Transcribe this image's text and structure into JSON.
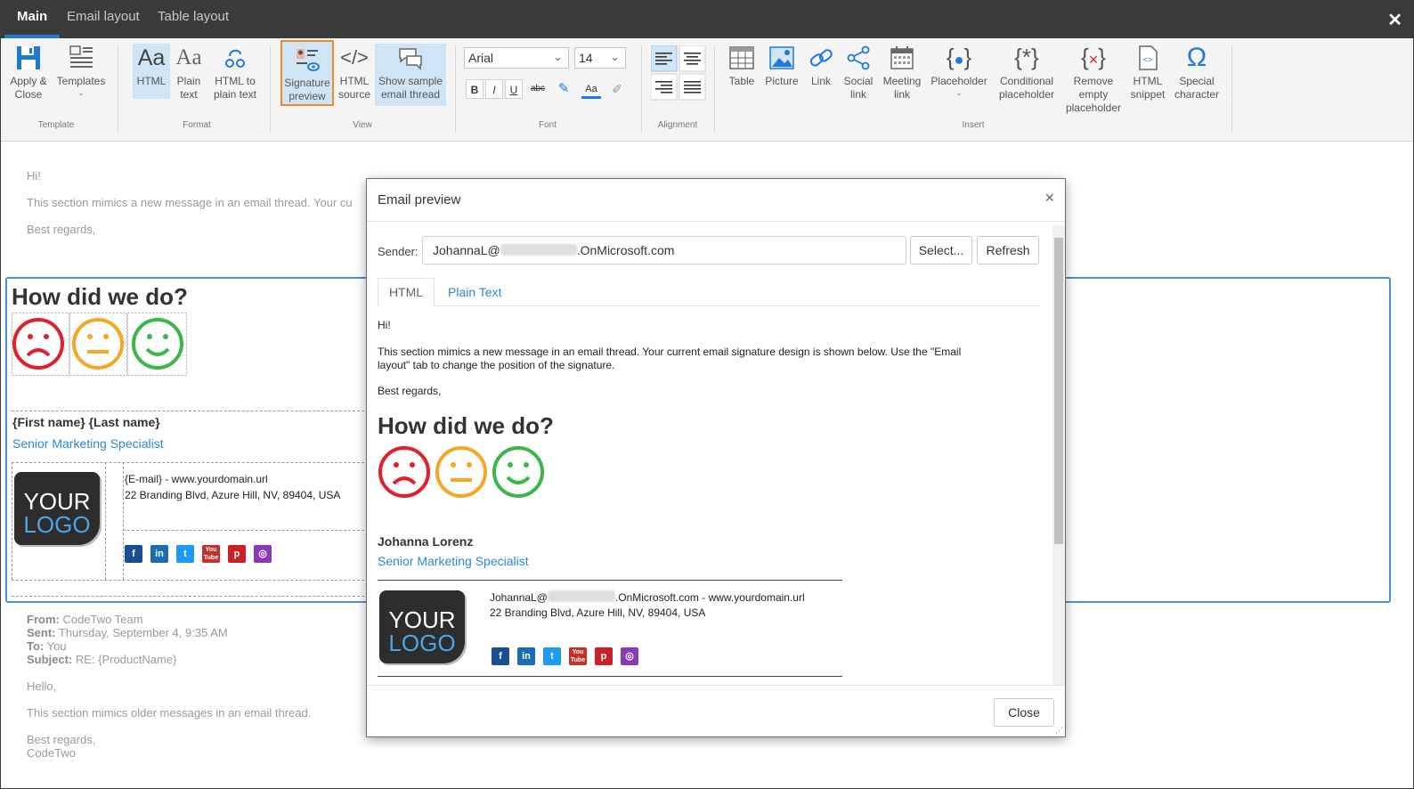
{
  "tabs": [
    "Main",
    "Email layout",
    "Table layout"
  ],
  "window_close": "✕",
  "ribbon": {
    "template": {
      "label": "Template",
      "apply_close": [
        "Apply &",
        "Close"
      ],
      "templates": "Templates"
    },
    "format": {
      "label": "Format",
      "html": "HTML",
      "plain_text": [
        "Plain",
        "text"
      ],
      "html_to_plain": [
        "HTML to",
        "plain text"
      ]
    },
    "view": {
      "label": "View",
      "signature_preview": [
        "Signature",
        "preview"
      ],
      "html_source": [
        "HTML",
        "source"
      ],
      "show_sample": [
        "Show sample",
        "email thread"
      ]
    },
    "font": {
      "label": "Font",
      "family": "Arial",
      "size": "14",
      "bold": "B",
      "italic": "I",
      "underline": "U",
      "strikethrough": "abc",
      "font_color": "Aa"
    },
    "alignment": {
      "label": "Alignment"
    },
    "insert": {
      "label": "Insert",
      "table": "Table",
      "picture": "Picture",
      "link": "Link",
      "social_link": [
        "Social",
        "link"
      ],
      "meeting_link": [
        "Meeting",
        "link"
      ],
      "placeholder": "Placeholder",
      "conditional_placeholder": [
        "Conditional",
        "placeholder"
      ],
      "remove_empty_placeholder": [
        "Remove",
        "empty",
        "placeholder"
      ],
      "html_snippet": [
        "HTML",
        "snippet"
      ],
      "special_character": [
        "Special",
        "character"
      ]
    }
  },
  "editor": {
    "greeting": "Hi!",
    "intro": "This section mimics a new message in an email thread. Your cu",
    "regards": "Best regards,",
    "survey_title": "How did we do?",
    "name_placeholder": "{First name} {Last name}",
    "job_title": "Senior Marketing Specialist",
    "logo": [
      "YOUR",
      "LOGO"
    ],
    "contact_line": "{E-mail} - www.yourdomain.url",
    "address": "22 Branding Blvd, Azure Hill, NV, 89404, USA",
    "quoted": {
      "from_label": "From:",
      "from_value": "CodeTwo Team",
      "sent_label": "Sent:",
      "sent_value": "Thursday, September 4, 9:35 AM",
      "to_label": "To:",
      "to_value": "You",
      "subject_label": "Subject:",
      "subject_value": "RE: {ProductName}",
      "hello": "Hello,",
      "body": "This section mimics older messages in an email thread.",
      "regards": "Best regards,",
      "signoff": "CodeTwo"
    }
  },
  "social_icons": [
    {
      "name": "facebook-icon",
      "glyph": "f",
      "color": "#1a4e93"
    },
    {
      "name": "linkedin-icon",
      "glyph": "in",
      "color": "#1a6db5"
    },
    {
      "name": "twitter-icon",
      "glyph": "t",
      "color": "#1d9bf0"
    },
    {
      "name": "youtube-icon",
      "glyph": "You Tube",
      "color": "#c4302b"
    },
    {
      "name": "pinterest-icon",
      "glyph": "p",
      "color": "#cb2027"
    },
    {
      "name": "instagram-icon",
      "glyph": "◎",
      "color": "#8a3ab9"
    }
  ],
  "preview": {
    "title": "Email preview",
    "close_x": "×",
    "sender_label": "Sender:",
    "sender_prefix": "JohannaL@",
    "sender_suffix": ".OnMicrosoft.com",
    "select_button": "Select...",
    "refresh_button": "Refresh",
    "tab_html": "HTML",
    "tab_plain": "Plain Text",
    "greeting": "Hi!",
    "intro_line1": "This section mimics a new message in an email thread. Your current email signature design is shown below. Use the \"Email",
    "intro_line2": "layout\" tab to change the position of the signature.",
    "regards": "Best regards,",
    "survey_title": "How did we do?",
    "name": "Johanna Lorenz",
    "job_title": "Senior Marketing Specialist",
    "email_prefix": "JohannaL@",
    "email_suffix": ".OnMicrosoft.com - www.yourdomain.url",
    "address": "22 Branding Blvd, Azure Hill, NV, 89404, USA",
    "logo": [
      "YOUR",
      "LOGO"
    ],
    "close_button": "Close"
  },
  "colors": {
    "accent": "#1e7ad6",
    "sad": "#e0202a",
    "neutral": "#f5a623",
    "happy": "#3cb54a",
    "highlight": "#f08a24"
  }
}
